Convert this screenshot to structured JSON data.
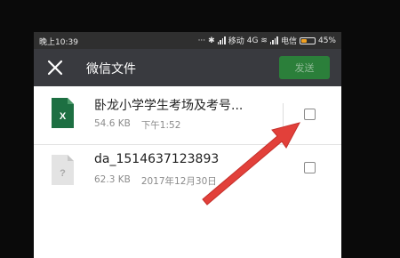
{
  "status_bar": {
    "time": "晚上10:39",
    "carrier1": "移动",
    "network": "4G",
    "carrier2": "电信",
    "battery": "45%",
    "battery_level": 0.45
  },
  "app_bar": {
    "title": "微信文件",
    "send_label": "发送",
    "close_icon": "close-icon"
  },
  "files": [
    {
      "name": "卧龙小学学生考场及考号...",
      "size": "54.6 KB",
      "time": "下午1:52",
      "icon": "excel-file-icon",
      "icon_letter": "X",
      "icon_color": "#1d6f42",
      "checked": false
    },
    {
      "name": "da_1514637123893",
      "size": "62.3 KB",
      "time": "2017年12月30日",
      "icon": "unknown-file-icon",
      "icon_letter": "?",
      "icon_color": "#d9d9d9",
      "checked": false
    }
  ],
  "colors": {
    "appbar": "#393a3f",
    "send_button": "#2b7f3a",
    "annotation_arrow": "#e2403a"
  }
}
